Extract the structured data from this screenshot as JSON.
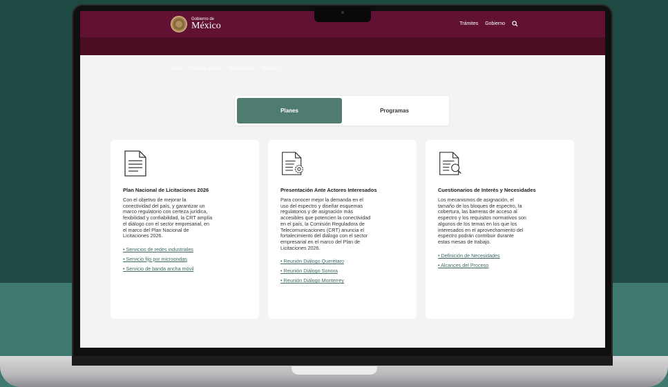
{
  "header": {
    "logo_small": "Gobierno de",
    "logo_big": "México",
    "top_links": [
      "Trámites",
      "Gobierno"
    ],
    "nav": [
      "Inicio",
      "Consulta pública",
      "Herramientas",
      "Directorio"
    ]
  },
  "tabs": [
    {
      "label": "Planes",
      "active": true
    },
    {
      "label": "Programas",
      "active": false
    }
  ],
  "cards": [
    {
      "icon": "document-icon",
      "title": "Plan Nacional de Licitaciones 2026",
      "body_lines": [
        "Con el objetivo de mejorar la",
        "conectividad del país, y garantizar un",
        "marco regulatorio con certeza jurídica,",
        "fexibilidad y confiabilidad, la CRT amplía",
        "el diálogo con el sector empresarial, en",
        "el marco del Plan Nacional de",
        "Licitaciones 2026."
      ],
      "links": [
        "• Servicios de redes industriales",
        "• Servicio fijo por microondas",
        "• Servicio de banda ancha móvil"
      ]
    },
    {
      "icon": "document-gear-icon",
      "title": "Presentación Ante Actores Interesados",
      "body_lines": [
        "Para conocer mejor la demanda en el",
        "uso del espectro y diseñar esquemas",
        "regulatorios y de asignación más",
        "accesibles que potencien la conectividad",
        "en el país, la Comisión Reguladora de",
        "Telecomunicaciones (CRT) anuncia el",
        "fortalecimiento del diálogo con el sector",
        "empresarial en el marco del Plan de",
        "Licitaciones 2026."
      ],
      "links": [
        "• Reunión Diálogo Querétaro",
        "• Reunión Diálogo Sonora",
        "• Reunión Diálogo Monterrey"
      ]
    },
    {
      "icon": "document-search-icon",
      "title": "Cuestionarios de Interés y Necesidades",
      "body_lines": [
        "Los mecanismos de asignación, el",
        "tamaño de los bloques de espectro, la",
        "cobertura, las barreras de acceso al",
        "espectro y los requisitos normativos son",
        "algunos de los temas en los que los",
        "interesados en el aprovechamiento del",
        "espectro podrán contribuir durante",
        "estas mesas de trabajo."
      ],
      "links": [
        "• Definición de Necesidades",
        "• Alcances del Proceso"
      ]
    }
  ],
  "colors": {
    "header": "#611232",
    "subheader": "#4a0d24",
    "tab_active": "#4f7b71",
    "link": "#3c6a62"
  }
}
